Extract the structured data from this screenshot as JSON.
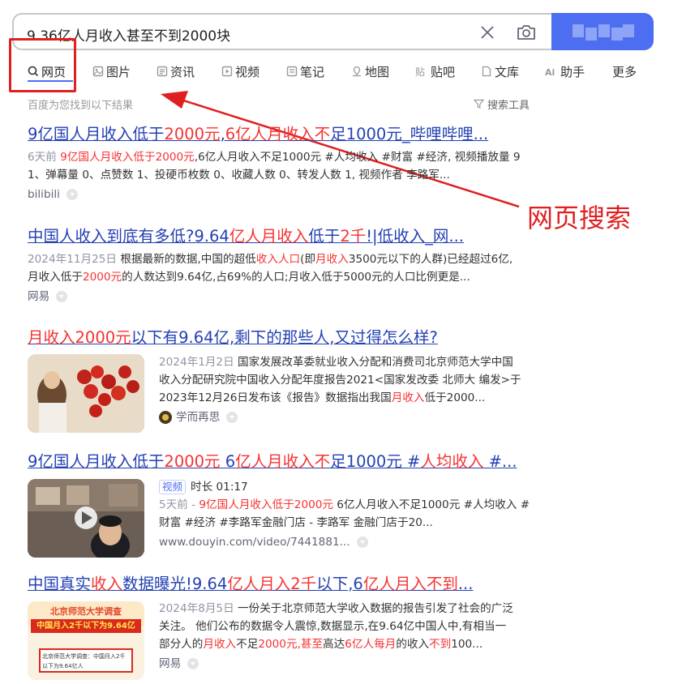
{
  "search": {
    "query": "9.36亿人月收入甚至不到2000块"
  },
  "tabs": [
    {
      "label": "网页",
      "icon": "search-icon"
    },
    {
      "label": "图片",
      "icon": "image-icon"
    },
    {
      "label": "资讯",
      "icon": "news-icon"
    },
    {
      "label": "视频",
      "icon": "video-icon"
    },
    {
      "label": "笔记",
      "icon": "note-icon"
    },
    {
      "label": "地图",
      "icon": "map-icon"
    },
    {
      "label": "贴吧",
      "icon": "tieba-icon"
    },
    {
      "label": "文库",
      "icon": "doc-icon"
    },
    {
      "label": "助手",
      "icon": "ai-icon"
    },
    {
      "label": "更多",
      "icon": ""
    }
  ],
  "result_count": "百度为您找到以下结果",
  "tools_label": "搜索工具",
  "annotation": {
    "label": "网页搜索",
    "color": "#e02020"
  },
  "results": [
    {
      "title_parts": [
        "9亿国人月收入低于",
        "2000元",
        ",",
        "6亿人月收入不",
        "足1000元_哔哩哔哩..."
      ],
      "date": "6天前",
      "abstract_hl": "9亿国人月收入低于2000元",
      "abstract_1": ",6亿人月收入不足1000元 #人均收入 #财富 #经济, 视频播放量 9",
      "abstract_2": "1、弹幕量 0、点赞数 1、投硬币枚数 0、收藏人数 0、转发人数 1, 视频作者 李路军...",
      "source": "bilibili"
    },
    {
      "title_parts": [
        "中国人收入到底有多低?9.64",
        "亿人月收入",
        "低于",
        "2千",
        "!|低收入_网..."
      ],
      "date": "2024年11月25日",
      "abstract_1a": "根据最新的数据,中国的超低",
      "abstract_1b": "收入人口",
      "abstract_1c": "(即",
      "abstract_1d": "月收入",
      "abstract_1e": "3500元以下的人群)已经超过6亿,",
      "abstract_2a": "月收入低于",
      "abstract_2b": "2000元",
      "abstract_2c": "的人数达到9.64亿,占69%的人口;月收入低于5000元的人口比例更是...",
      "source": "网易"
    },
    {
      "title_parts": [
        "月收入2000元",
        "以下有9.64亿,剩下的那些人,又过得怎么样?"
      ],
      "date": "2024年1月2日",
      "abstract_1": "国家发展改革委就业收入分配和消费司北京师范大学中国",
      "abstract_2": "收入分配研究院中国收入分配年度报告2021<国家发改委 北师大 编发>于",
      "abstract_3a": "2023年12月26日发布该《报告》数据指出我国",
      "abstract_3b": "月收入",
      "abstract_3c": "低于2000...",
      "source": "学而再思"
    },
    {
      "title_parts": [
        "9亿国人月收入低于",
        "2000元",
        " 6",
        "亿人月收入不",
        "足1000元 #",
        "人均收入",
        " #..."
      ],
      "tag": "视频",
      "duration": "时长 01:17",
      "date": "5天前 - ",
      "abstract_hl": "9亿国人月收入低于2000元",
      "abstract_1": " 6亿人月收入不足1000元 #人均收入 #",
      "abstract_2": "财富 #经济 #李路军金融门店 - 李路军 金融门店于20...",
      "source": "www.douyin.com/video/7441881..."
    },
    {
      "title_parts": [
        "中国真实",
        "收入",
        "数据曝光!9.64",
        "亿人月入2千",
        "以下,6",
        "亿人月入不到",
        "..."
      ],
      "date": "2024年8月5日",
      "abstract_1": "一份关于北京师范大学收入数据的报告引发了社会的广泛",
      "abstract_2": "关注。 他们公布的数据令人震惊,数据显示,在9.64亿中国人中,有相当一",
      "abstract_3a": "部分人的",
      "abstract_3b": "月收入",
      "abstract_3c": "不足",
      "abstract_3d": "2000元,甚至",
      "abstract_3e": "高达",
      "abstract_3f": "6亿人每月",
      "abstract_3g": "的收入",
      "abstract_3h": "不到",
      "abstract_3i": "100...",
      "source": "网易",
      "thumb_text_1": "北京师范大学调查",
      "thumb_text_2": "中国月入2千以下为9.64亿",
      "thumb_text_3": "北京师范大学调查：中国月入2千以下为9.64亿人"
    }
  ]
}
